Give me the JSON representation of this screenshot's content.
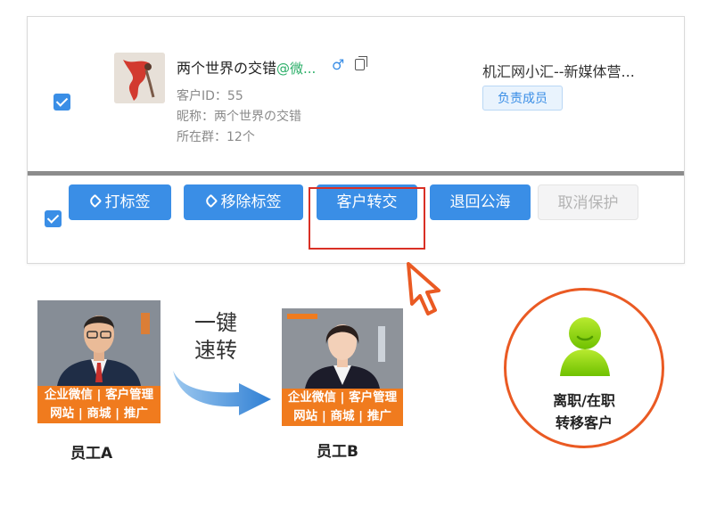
{
  "customer": {
    "name": "两个世界の交错",
    "wechat_suffix": "@微...",
    "gender_symbol": "♂",
    "id_line": "客户ID：55",
    "nickname_line": "昵称：两个世界の交错",
    "group_line": "所在群：12个",
    "org_name": "机汇网小汇--新媒体营...",
    "role_tag": "负责成员",
    "selected": true
  },
  "actions": {
    "select_all": true,
    "tag_label": "打标签",
    "remove_tag_label": "移除标签",
    "transfer_label": "客户转交",
    "return_pool_label": "退回公海",
    "cancel_protect_label": "取消保护"
  },
  "illustration": {
    "quick_line1": "一键",
    "quick_line2": "速转",
    "employee_a": {
      "label": "员工A",
      "band_line1": "企业微信 | 客户管理",
      "band_line2": "网站 | 商城 | 推广"
    },
    "employee_b": {
      "label": "员工B",
      "band_line1": "企业微信 | 客户管理",
      "band_line2": "网站 | 商城 | 推广"
    },
    "circle_line1": "离职/在职",
    "circle_line2": "转移客户"
  },
  "colors": {
    "primary": "#3a8ee6",
    "highlight_border": "#d93025",
    "accent_orange": "#ea5a23",
    "band_orange": "#f07b1e",
    "icon_green": "#8cd400"
  }
}
